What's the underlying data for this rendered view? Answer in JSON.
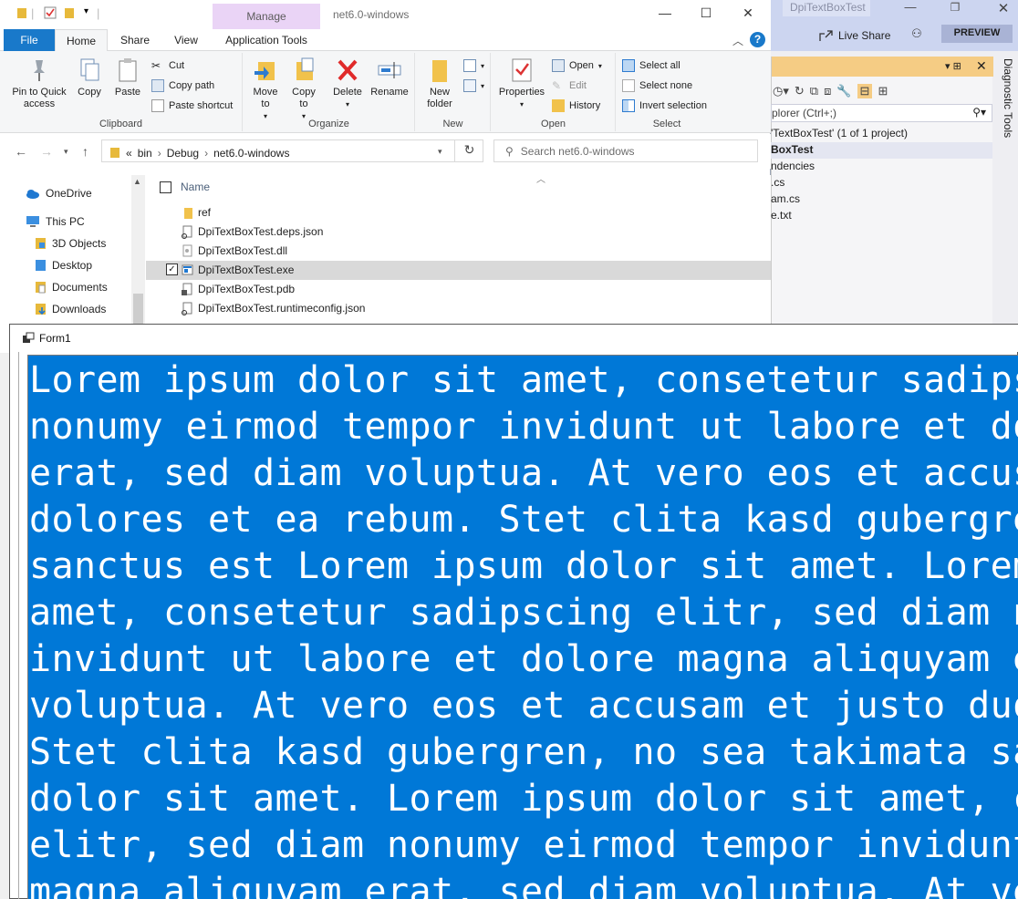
{
  "vs": {
    "tab_title": "DpiTextBoxTest",
    "live_share": "Live Share",
    "preview": "PREVIEW",
    "side_tab": "Diagnostic Tools",
    "search_text": "plorer (Ctrl+;)",
    "tree": [
      "'TextBoxTest' (1 of 1 project)",
      "BoxTest",
      "ndencies",
      ".cs",
      "am.cs",
      "e.txt"
    ]
  },
  "explorer": {
    "window_title": "net6.0-windows",
    "manage_tab": "Manage",
    "tabs": {
      "file": "File",
      "home": "Home",
      "share": "Share",
      "view": "View",
      "app_tools": "Application Tools"
    },
    "ribbon": {
      "clipboard": {
        "label": "Clipboard",
        "pin": "Pin to Quick access",
        "copy": "Copy",
        "paste": "Paste",
        "cut": "Cut",
        "copy_path": "Copy path",
        "paste_shortcut": "Paste shortcut"
      },
      "organize": {
        "label": "Organize",
        "move_to": "Move to",
        "copy_to": "Copy to",
        "delete": "Delete",
        "rename": "Rename"
      },
      "new": {
        "label": "New",
        "new_folder": "New folder"
      },
      "open": {
        "label": "Open",
        "properties": "Properties",
        "open": "Open",
        "edit": "Edit",
        "history": "History"
      },
      "select": {
        "label": "Select",
        "select_all": "Select all",
        "select_none": "Select none",
        "invert_selection": "Invert selection"
      }
    },
    "address": {
      "prefix": "«",
      "parts": [
        "bin",
        "Debug",
        "net6.0-windows"
      ]
    },
    "search_placeholder": "Search net6.0-windows",
    "nav": [
      {
        "label": "OneDrive",
        "icon": "cloud-icon"
      },
      {
        "label": "This PC",
        "icon": "computer-icon"
      },
      {
        "label": "3D Objects",
        "icon": "3d-objects-icon"
      },
      {
        "label": "Desktop",
        "icon": "desktop-icon"
      },
      {
        "label": "Documents",
        "icon": "documents-icon"
      },
      {
        "label": "Downloads",
        "icon": "downloads-icon"
      }
    ],
    "column_name": "Name",
    "files": [
      {
        "name": "ref",
        "icon": "folder-icon",
        "selected": false
      },
      {
        "name": "DpiTextBoxTest.deps.json",
        "icon": "json-file-icon",
        "selected": false
      },
      {
        "name": "DpiTextBoxTest.dll",
        "icon": "dll-file-icon",
        "selected": false
      },
      {
        "name": "DpiTextBoxTest.exe",
        "icon": "exe-file-icon",
        "selected": true
      },
      {
        "name": "DpiTextBoxTest.pdb",
        "icon": "pdb-file-icon",
        "selected": false
      },
      {
        "name": "DpiTextBoxTest.runtimeconfig.json",
        "icon": "json-file-icon",
        "selected": false
      }
    ]
  },
  "form": {
    "title": "Form1",
    "selection_color": "#0078d7",
    "lines": [
      "Lorem ipsum dolor sit amet, consetetur sadipsc",
      "nonumy eirmod tempor invidunt ut labore et dol",
      "erat, sed diam voluptua. At vero eos et accusa",
      "dolores et ea rebum. Stet clita kasd gubergren",
      "sanctus est Lorem ipsum dolor sit amet. Lorem",
      "amet, consetetur sadipscing elitr, sed diam no",
      "invidunt ut labore et dolore magna aliquyam er",
      "voluptua. At vero eos et accusam et justo duo",
      "Stet clita kasd gubergren, no sea takimata san",
      "dolor sit amet. Lorem ipsum dolor sit amet, co",
      "elitr, sed diam nonumy eirmod tempor invidunt",
      "magna aliquyam erat, sed diam voluptua. At ver"
    ]
  }
}
